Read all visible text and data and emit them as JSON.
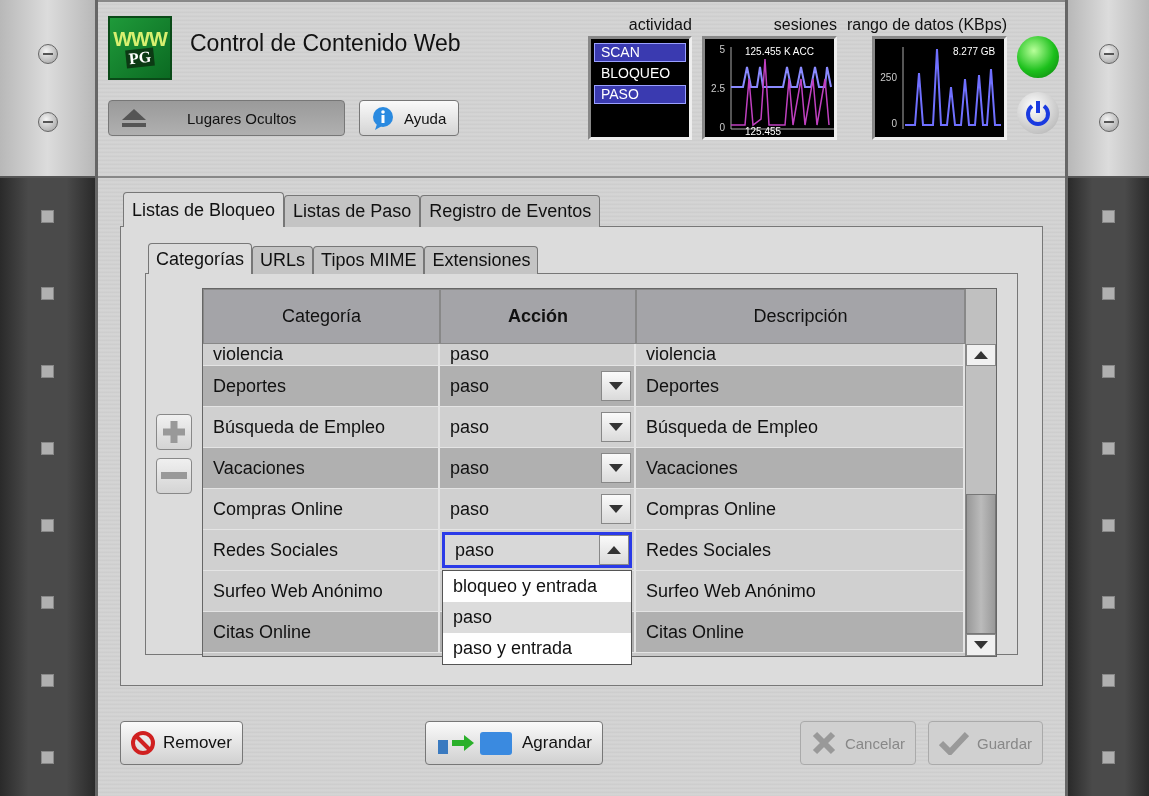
{
  "app": {
    "title": "Control de Contenido Web",
    "logo": {
      "top": "WWW",
      "bottom": "PG"
    }
  },
  "header_buttons": [
    {
      "label": "Lugares Ocultos",
      "kind": "eject",
      "pressed": true
    },
    {
      "label": "Ayuda",
      "kind": "help",
      "pressed": false
    }
  ],
  "monitors": {
    "activity": {
      "label": "actividad",
      "items": [
        {
          "label": "SCAN",
          "active": true
        },
        {
          "label": "BLOQUEO",
          "active": false
        },
        {
          "label": "PASO",
          "active": true
        }
      ]
    },
    "sessions": {
      "label": "sesiones",
      "yticks": [
        "5",
        "2.5",
        "0"
      ],
      "top_reading": "125.455 K ACC",
      "bottom_reading": "125.455"
    },
    "data_rate": {
      "label": "rango de datos (KBps)",
      "yticks": [
        "250",
        "0"
      ],
      "reading": "8.277 GB"
    }
  },
  "status_led": {
    "on": true
  },
  "tabs": [
    {
      "label": "Listas de Bloqueo",
      "selected": true
    },
    {
      "label": "Listas de Paso",
      "selected": false
    },
    {
      "label": "Registro de Eventos",
      "selected": false
    }
  ],
  "subtabs": [
    {
      "label": "Categorías",
      "selected": true
    },
    {
      "label": "URLs",
      "selected": false
    },
    {
      "label": "Tipos MIME",
      "selected": false
    },
    {
      "label": "Extensiones",
      "selected": false
    }
  ],
  "side_buttons": [
    {
      "kind": "add"
    },
    {
      "kind": "remove"
    }
  ],
  "table": {
    "columns": [
      {
        "label": "Categoría",
        "bold": false
      },
      {
        "label": "Acción",
        "bold": true
      },
      {
        "label": "Descripción",
        "bold": false
      }
    ],
    "rows": [
      {
        "category": "violencia",
        "action": "paso",
        "description": "violencia",
        "shaded": false
      },
      {
        "category": "Deportes",
        "action": "paso",
        "description": "Deportes",
        "shaded": true
      },
      {
        "category": "Búsqueda de Empleo",
        "action": "paso",
        "description": "Búsqueda de Empleo",
        "shaded": false
      },
      {
        "category": "Vacaciones",
        "action": "paso",
        "description": "Vacaciones",
        "shaded": true
      },
      {
        "category": "Compras Online",
        "action": "paso",
        "description": "Compras Online",
        "shaded": false
      },
      {
        "category": "Redes Sociales",
        "action": "paso",
        "description": "Redes Sociales",
        "shaded": false,
        "open": true,
        "options": [
          {
            "label": "bloqueo y entrada",
            "selected": false
          },
          {
            "label": "paso",
            "selected": true
          },
          {
            "label": "paso y entrada",
            "selected": false
          }
        ]
      },
      {
        "category": "Surfeo Web Anónimo",
        "description": "Surfeo Web Anónimo",
        "shaded": false
      },
      {
        "category": "Citas Online",
        "description": "Citas Online",
        "shaded": true
      }
    ]
  },
  "footer_buttons": [
    {
      "label": "Remover",
      "kind": "remove",
      "disabled": false
    },
    {
      "label": "Agrandar",
      "kind": "export",
      "disabled": false
    },
    {
      "label": "Cancelar",
      "kind": "cancel",
      "disabled": true
    },
    {
      "label": "Guardar",
      "kind": "save",
      "disabled": true
    }
  ]
}
